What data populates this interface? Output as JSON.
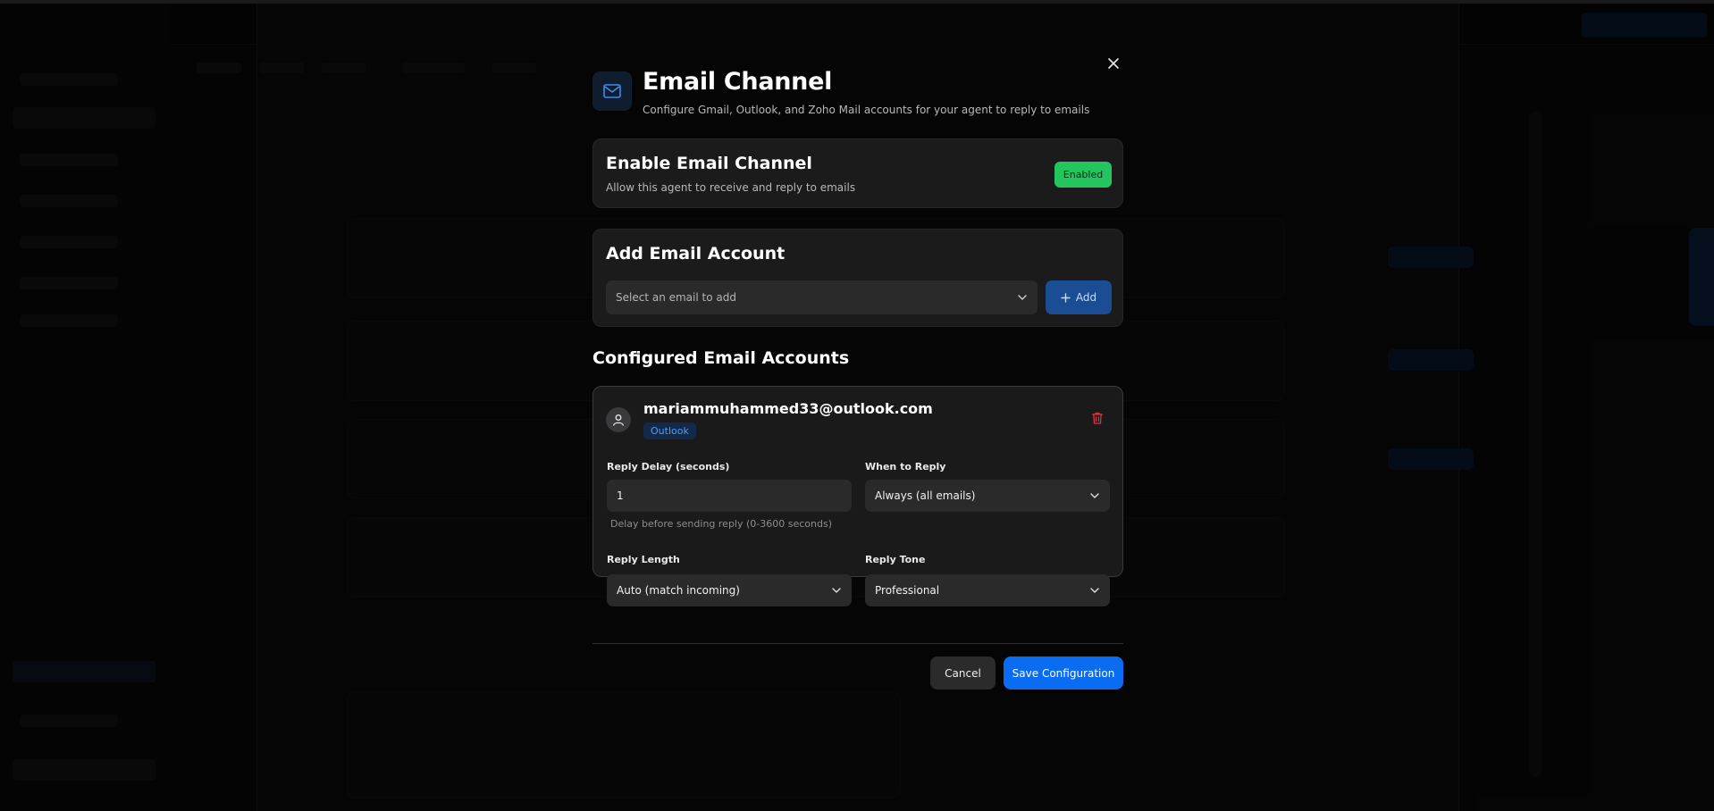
{
  "modal": {
    "title": "Email Channel",
    "subtitle": "Configure Gmail, Outlook, and Zoho Mail accounts for your agent to reply to emails",
    "close_icon": "close-icon",
    "header_icon": "mail-icon"
  },
  "enable_section": {
    "title": "Enable Email Channel",
    "description": "Allow this agent to receive and reply to emails",
    "status": "Enabled",
    "status_color": "#22c55e"
  },
  "add_section": {
    "title": "Add Email Account",
    "select_placeholder": "Select an email to add",
    "add_label": "Add"
  },
  "configured": {
    "title": "Configured Email Accounts",
    "accounts": [
      {
        "email": "mariammuhammed33@outlook.com",
        "provider": "Outlook",
        "reply_delay_label": "Reply Delay (seconds)",
        "reply_delay_value": "1",
        "reply_delay_hint": "Delay before sending reply (0-3600 seconds)",
        "when_to_reply_label": "When to Reply",
        "when_to_reply_value": "Always (all emails)",
        "reply_length_label": "Reply Length",
        "reply_length_value": "Auto (match incoming)",
        "reply_tone_label": "Reply Tone",
        "reply_tone_value": "Professional"
      }
    ]
  },
  "footer": {
    "cancel_label": "Cancel",
    "save_label": "Save Configuration"
  },
  "colors": {
    "accent": "#0a6cf0",
    "danger": "#e0314b",
    "provider_badge": "#5a9be8"
  }
}
